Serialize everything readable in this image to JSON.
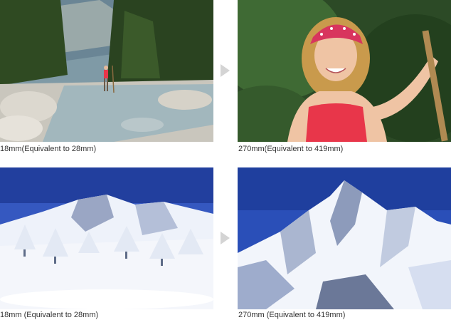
{
  "rows": [
    {
      "subject": "riverbed",
      "wide": {
        "caption": "18mm(Equivalent to 28mm)"
      },
      "tele": {
        "caption": "270mm(Equivalent to 419mm)"
      },
      "arrow_icon": "right-triangle-arrow"
    },
    {
      "subject": "snow-mountain",
      "wide": {
        "caption": "18mm  (Equivalent to 28mm)"
      },
      "tele": {
        "caption": "270mm  (Equivalent to 419mm)"
      },
      "arrow_icon": "right-triangle-arrow"
    }
  ],
  "colors": {
    "caption_text": "#333333",
    "arrow": "#d4d4d4",
    "sky": "#2a4fb8",
    "shirt": "#e8364a",
    "bandana": "#d8355e"
  }
}
